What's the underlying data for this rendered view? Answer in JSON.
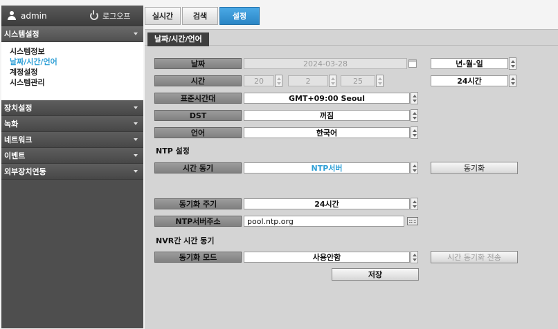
{
  "user": {
    "name": "admin",
    "logout": "로그오프"
  },
  "tabs": [
    {
      "label": "실시간"
    },
    {
      "label": "검색"
    },
    {
      "label": "설정"
    }
  ],
  "sidebar": {
    "system": "시스템설정",
    "system_items": [
      "시스템정보",
      "날짜/시간/언어",
      "계정설정",
      "시스템관리"
    ],
    "menus": [
      "장치설정",
      "녹화",
      "네트워크",
      "이벤트",
      "외부장치연동"
    ]
  },
  "subtab": "날짜/시간/언어",
  "form": {
    "date": {
      "label": "날짜",
      "value": "2024-03-28",
      "format": "년-월-일"
    },
    "time": {
      "label": "시간",
      "hour": "20",
      "minute": "2",
      "second": "25",
      "format": "24시간"
    },
    "timezone": {
      "label": "표준시간대",
      "value": "GMT+09:00 Seoul"
    },
    "dst": {
      "label": "DST",
      "value": "꺼짐"
    },
    "language": {
      "label": "언어",
      "value": "한국어"
    },
    "ntp_section": "NTP 설정",
    "time_sync": {
      "label": "시간 동기",
      "value": "NTP서버",
      "button": "동기화"
    },
    "sync_period": {
      "label": "동기화 주기",
      "value": "24시간"
    },
    "ntp_address": {
      "label": "NTP서버주소",
      "value": "pool.ntp.org"
    },
    "nvr_section": "NVR간 시간 동기",
    "sync_mode": {
      "label": "동기화 모드",
      "value": "사용안함",
      "button": "시간 동기화 전송"
    },
    "save": "저장"
  },
  "colors": {
    "accent": "#2e9fd6",
    "tab_active": "#3a98d6"
  }
}
